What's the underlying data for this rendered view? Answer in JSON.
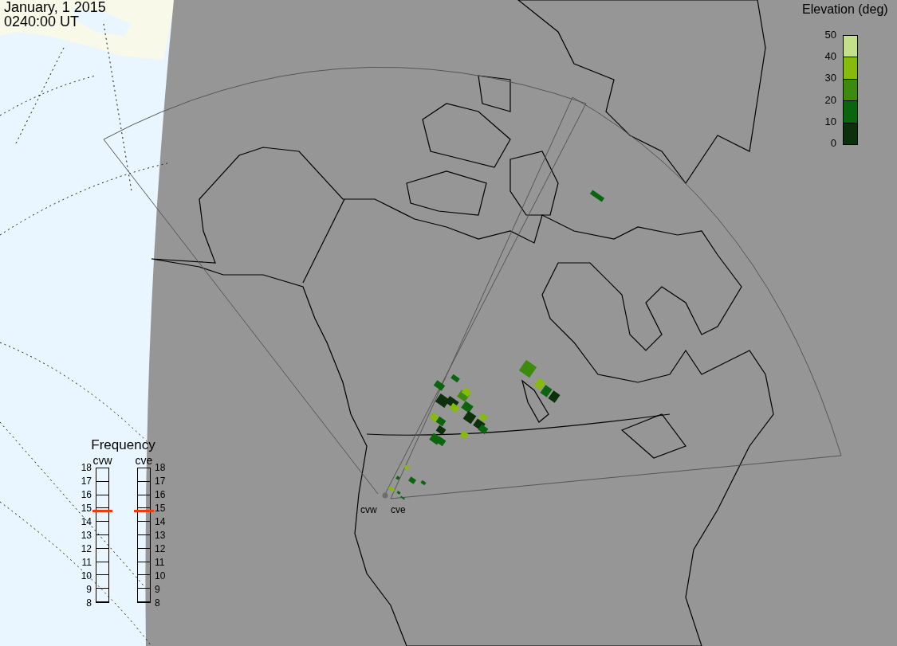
{
  "header": {
    "date": "January, 1 2015",
    "time": "0240:00 UT"
  },
  "colorbar": {
    "title": "Elevation (deg)",
    "segments": [
      {
        "color": "#c4e08a"
      },
      {
        "color": "#86ba0c"
      },
      {
        "color": "#3c8a0e"
      },
      {
        "color": "#0b640e"
      },
      {
        "color": "#0b300b"
      }
    ],
    "ticks": [
      "50",
      "40",
      "30",
      "20",
      "10",
      "0"
    ]
  },
  "frequency": {
    "title": "Frequency",
    "radars": [
      {
        "name": "cvw",
        "kind": "left-axis",
        "level": 0.685,
        "ticks": [
          "18",
          "17",
          "16",
          "15",
          "14",
          "13",
          "12",
          "11",
          "10",
          "9",
          "8"
        ]
      },
      {
        "name": "cve",
        "kind": "right-axis",
        "level": 0.685,
        "ticks": [
          "18",
          "17",
          "16",
          "15",
          "14",
          "13",
          "12",
          "11",
          "10",
          "9",
          "8"
        ]
      }
    ]
  },
  "stations": [
    {
      "name": "cvw",
      "kind": "radar-site"
    },
    {
      "name": "cve",
      "kind": "radar-site"
    }
  ]
}
